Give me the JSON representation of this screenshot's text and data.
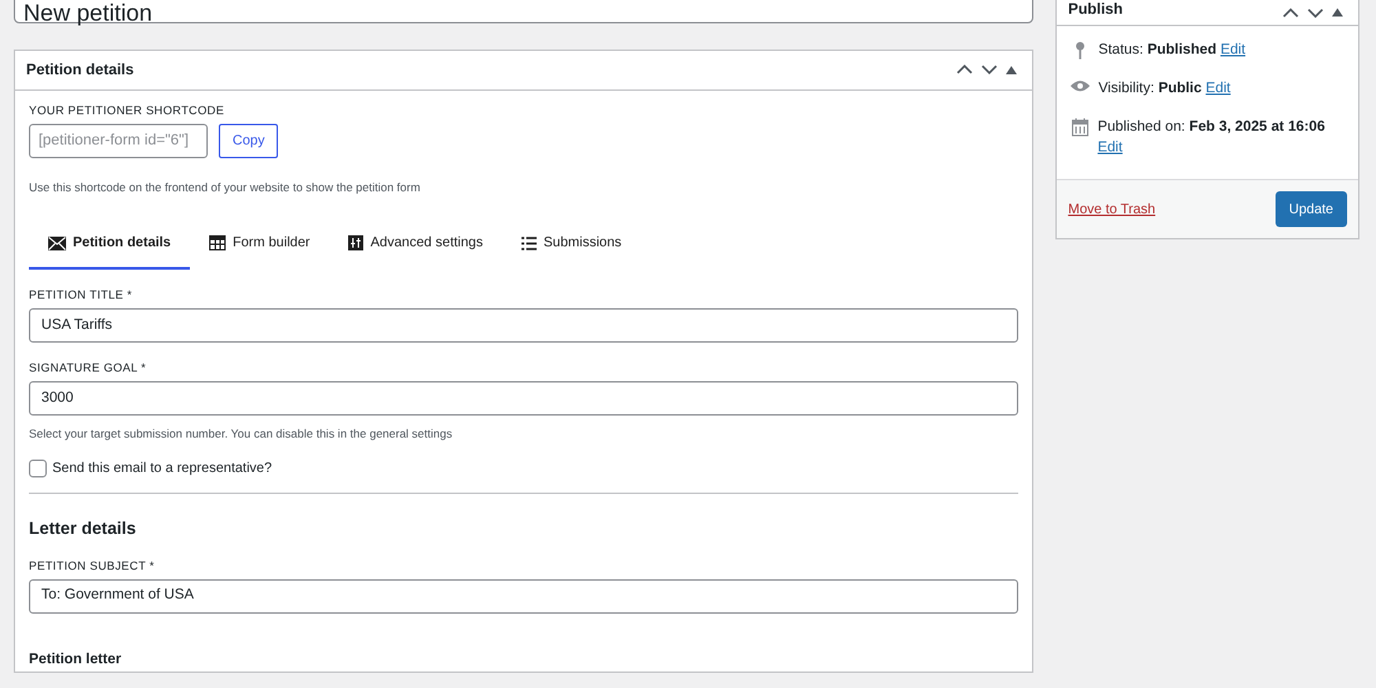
{
  "title_field": {
    "value": "New petition"
  },
  "details_box": {
    "title": "Petition details",
    "shortcode": {
      "label": "YOUR PETITIONER SHORTCODE",
      "value": "[petitioner-form id=\"6\"]",
      "button": "Copy",
      "help": "Use this shortcode on the frontend of your website to show the petition form"
    },
    "tabs": [
      {
        "label": "Petition details",
        "selected": true
      },
      {
        "label": "Form builder",
        "selected": false
      },
      {
        "label": "Advanced settings",
        "selected": false
      },
      {
        "label": "Submissions",
        "selected": false
      }
    ],
    "fields": [
      {
        "kind": "input",
        "label": "PETITION TITLE *",
        "value": "USA Tariffs"
      },
      {
        "kind": "input",
        "label": "SIGNATURE GOAL *",
        "value": "3000",
        "help": "Select your target submission number. You can disable this in the general settings"
      },
      {
        "kind": "checkbox",
        "label": "Send this email to a representative?",
        "checked": false
      },
      {
        "kind": "divider"
      },
      {
        "kind": "heading",
        "label": "Letter details"
      },
      {
        "kind": "input",
        "label": "PETITION SUBJECT *",
        "value": "To: Government of USA"
      },
      {
        "kind": "subheading",
        "label": "Petition letter"
      }
    ]
  },
  "publish_box": {
    "title": "Publish",
    "rows": [
      {
        "label": "Status:",
        "value": "Published",
        "link": "Edit"
      },
      {
        "label": "Visibility:",
        "value": "Public",
        "link": "Edit"
      },
      {
        "label": "Published on:",
        "value": "Feb 3, 2025 at 16:06",
        "link": "Edit"
      }
    ],
    "trash_link": "Move to Trash",
    "update_button": "Update"
  }
}
